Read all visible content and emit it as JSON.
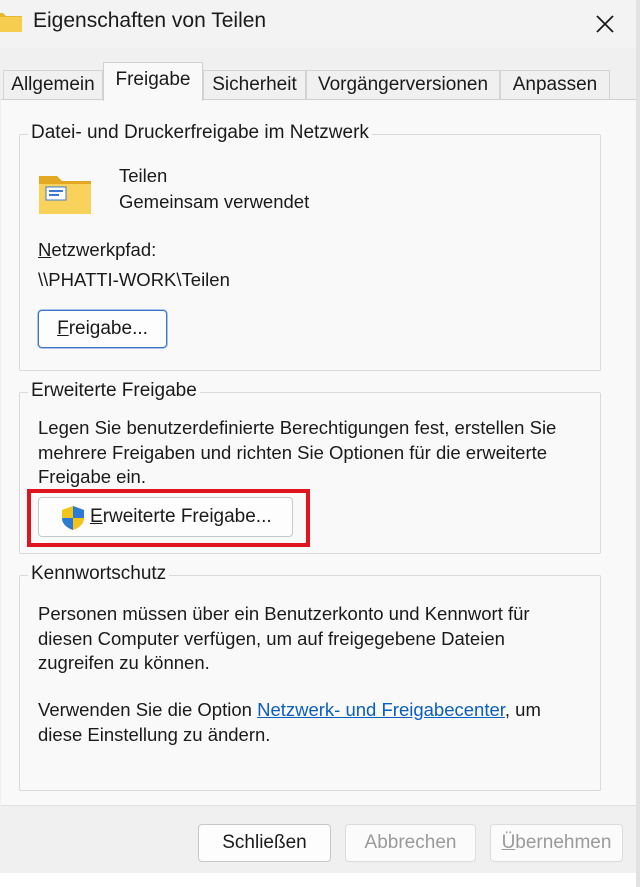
{
  "window": {
    "title": "Eigenschaften von Teilen",
    "folder_icon": "folder-icon",
    "close_icon": "close-icon"
  },
  "tabs": [
    {
      "label": "Allgemein",
      "active": false
    },
    {
      "label": "Freigabe",
      "active": true
    },
    {
      "label": "Sicherheit",
      "active": false
    },
    {
      "label": "Vorgängerversionen",
      "active": false
    },
    {
      "label": "Anpassen",
      "active": false
    }
  ],
  "network_sharing": {
    "group_label": "Datei- und Druckerfreigabe im Netzwerk",
    "icon": "shared-folder-icon",
    "item_name": "Teilen",
    "item_status": "Gemeinsam verwendet",
    "path_label_first": "N",
    "path_label_rest": "etzwerkpfad:",
    "path_value": "\\\\PHATTI-WORK\\Teilen",
    "share_button_first": "F",
    "share_button_rest": "reigabe..."
  },
  "advanced_sharing": {
    "group_label": "Erweiterte Freigabe",
    "description": "Legen Sie benutzerdefinierte Berechtigungen fest, erstellen Sie mehrere Freigaben und richten Sie Optionen für die erweiterte Freigabe ein.",
    "button_first": "E",
    "button_rest": "rweiterte Freigabe...",
    "button_icon": "uac-shield-icon",
    "highlight_color": "#e0141e"
  },
  "password_protection": {
    "group_label": "Kennwortschutz",
    "description": "Personen müssen über ein Benutzerkonto und Kennwort für diesen Computer verfügen, um auf freigegebene Dateien zugreifen zu können.",
    "option_prefix": "Verwenden Sie die Option ",
    "option_link": "Netzwerk- und Freigabecenter",
    "option_suffix": ", um diese Einstellung zu ändern.",
    "link_color": "#0a5ebd"
  },
  "footer": {
    "close_label": "Schließen",
    "cancel_label": "Abbrechen",
    "apply_first": "Ü",
    "apply_rest": "bernehmen"
  }
}
